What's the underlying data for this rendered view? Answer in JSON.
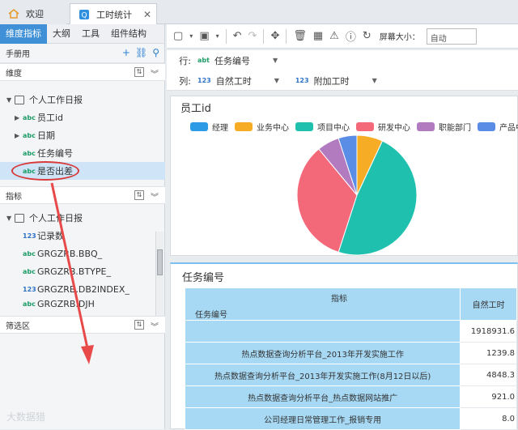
{
  "tabs": [
    {
      "label": "欢迎",
      "icon": "home-icon"
    },
    {
      "label": "工时统计",
      "icon": "report-icon"
    }
  ],
  "left": {
    "tabs": [
      "维度指标",
      "大纲",
      "工具",
      "组件结构"
    ],
    "manual_label": "手册用",
    "sections": {
      "dimensions": "维度",
      "measures": "指标",
      "filter": "筛选区"
    },
    "dim_root": "个人工作日报",
    "dim_items": [
      {
        "badge": "abc",
        "label": "员工id",
        "expandable": true
      },
      {
        "badge": "abc",
        "label": "日期",
        "expandable": true
      },
      {
        "badge": "abc",
        "label": "任务编号",
        "expandable": false
      },
      {
        "badge": "abc",
        "label": "是否出差",
        "expandable": false
      }
    ],
    "measure_root": "个人工作日报",
    "measure_items": [
      {
        "badge": "123",
        "label": "记录数"
      },
      {
        "badge": "abc",
        "label": "GRGZRB.BBQ_"
      },
      {
        "badge": "abc",
        "label": "GRGZRB.BTYPE_"
      },
      {
        "badge": "123",
        "label": "GRGZRB.DB2INDEX_"
      },
      {
        "badge": "abc",
        "label": "GRGZRB.DJH"
      }
    ]
  },
  "toolbar": {
    "zoom_label": "屏幕大小：",
    "zoom_value": "自动"
  },
  "fields": {
    "row_label": "行:",
    "row_field": {
      "badge": "abt",
      "label": "任务编号"
    },
    "col_label": "列:",
    "col_fields": [
      {
        "badge": "123",
        "label": "自然工时"
      },
      {
        "badge": "123",
        "label": "附加工时"
      }
    ]
  },
  "chart_data": {
    "type": "pie",
    "title": "员工id",
    "legend": [
      "经理",
      "业务中心",
      "项目中心",
      "研发中心",
      "职能部门",
      "产品中"
    ],
    "colors": [
      "#2d9be6",
      "#f7ac25",
      "#1fc1ae",
      "#f3697a",
      "#b27bbf",
      "#5a8de6"
    ],
    "values": [
      0,
      7,
      48,
      34,
      6,
      5
    ]
  },
  "table": {
    "title": "任务编号",
    "header_top": "指标",
    "header_left": "任务编号",
    "header_col": "自然工时",
    "rows": [
      {
        "name": "",
        "value": "1918931.6"
      },
      {
        "name": "热点数据查询分析平台_2013年开发实施工作",
        "value": "1239.8"
      },
      {
        "name": "热点数据查询分析平台_2013年开发实施工作(8月12日以后)",
        "value": "4848.3"
      },
      {
        "name": "热点数据查询分析平台_热点数据网站推广",
        "value": "921.0"
      },
      {
        "name": "公司经理日常管理工作_报销专用",
        "value": "8.0"
      }
    ]
  },
  "watermark": "大数据猎"
}
